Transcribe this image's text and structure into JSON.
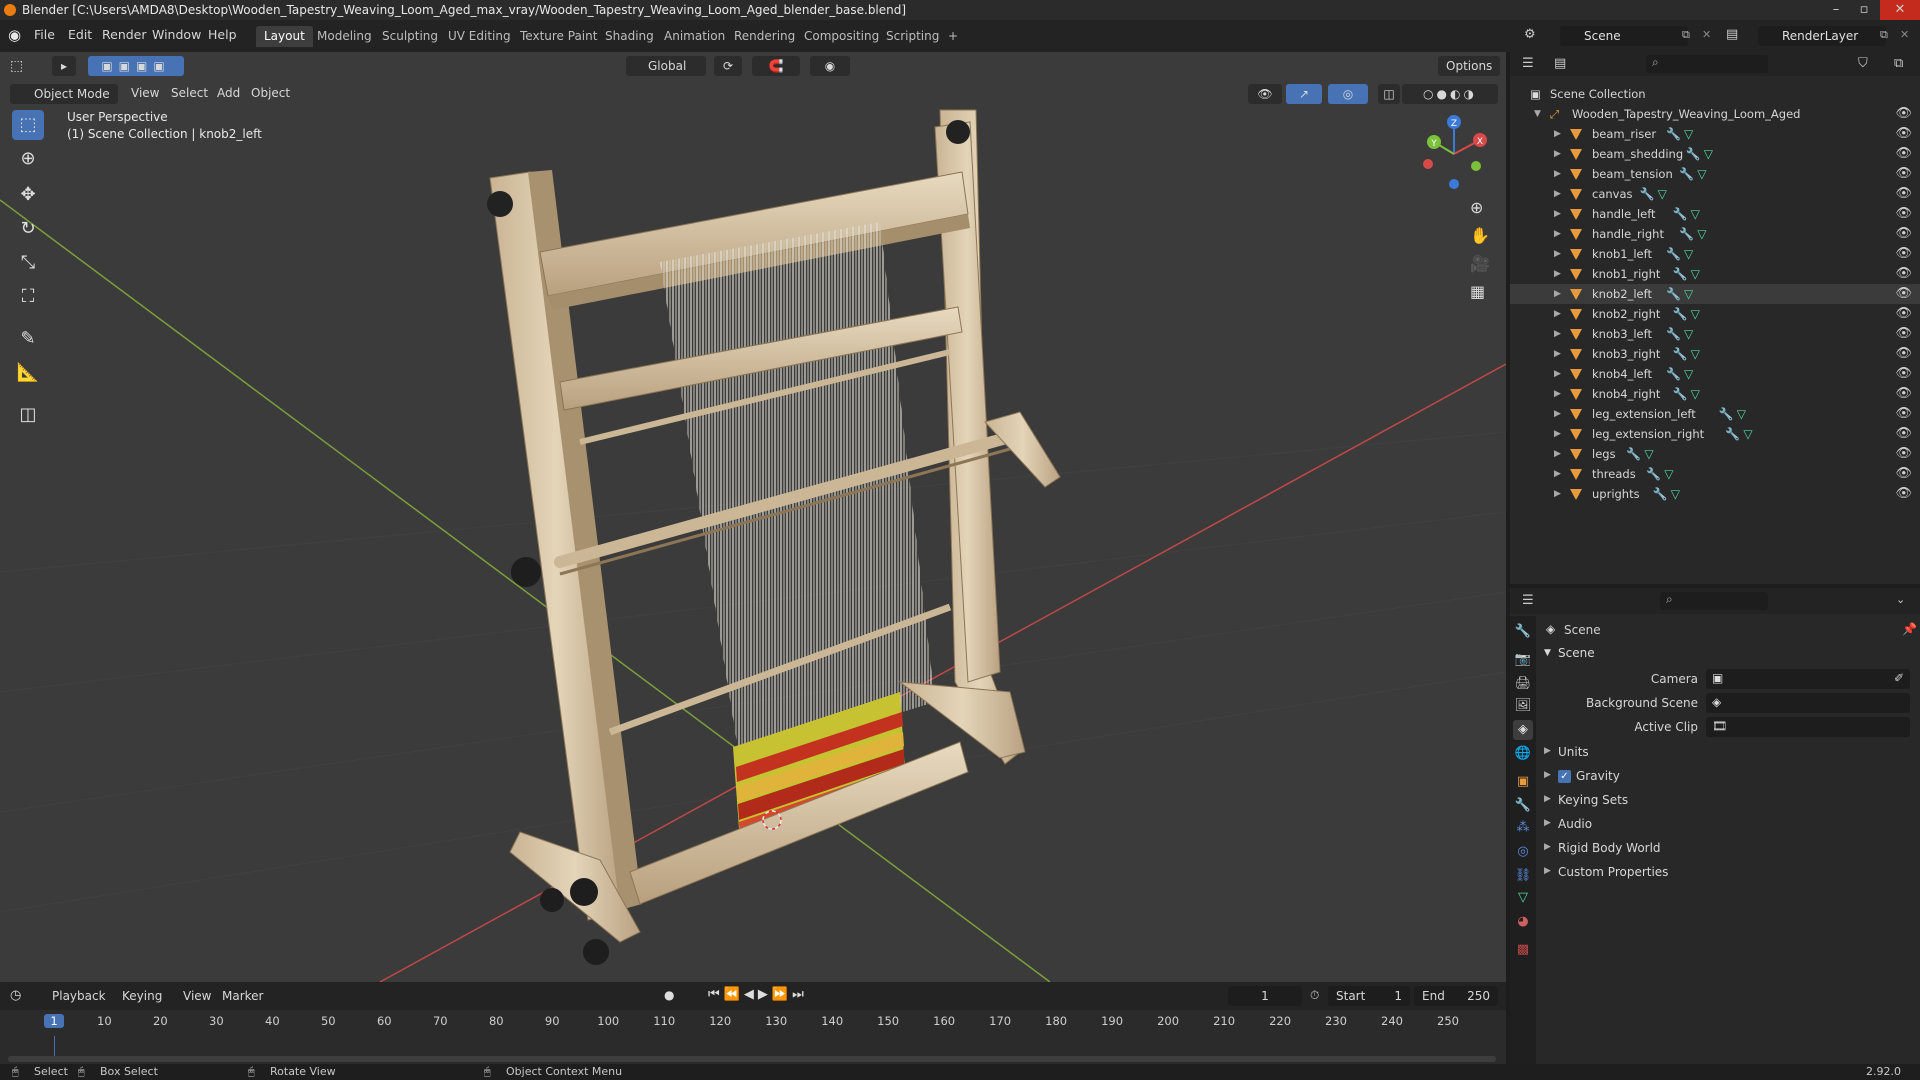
{
  "window": {
    "title": "Blender [C:\\Users\\AMDA8\\Desktop\\Wooden_Tapestry_Weaving_Loom_Aged_max_vray/Wooden_Tapestry_Weaving_Loom_Aged_blender_base.blend]"
  },
  "menu": [
    "File",
    "Edit",
    "Render",
    "Window",
    "Help"
  ],
  "workspaces": [
    {
      "label": "Layout",
      "active": true
    },
    {
      "label": "Modeling"
    },
    {
      "label": "Sculpting"
    },
    {
      "label": "UV Editing"
    },
    {
      "label": "Texture Paint"
    },
    {
      "label": "Shading"
    },
    {
      "label": "Animation"
    },
    {
      "label": "Rendering"
    },
    {
      "label": "Compositing"
    },
    {
      "label": "Scripting"
    }
  ],
  "add_workspace": "+",
  "scene_field": "Scene",
  "renderlayer_field": "RenderLayer",
  "viewport_header": {
    "transform_orientation": "Global",
    "options": "Options",
    "mode": "Object Mode",
    "menus": [
      "View",
      "Select",
      "Add",
      "Object"
    ]
  },
  "viewport": {
    "perspective": "User Perspective",
    "collection_info": "(1) Scene Collection | knob2_left",
    "gizmo_axes": {
      "x": "X",
      "y": "Y",
      "z": "Z"
    }
  },
  "outliner": {
    "root": "Scene Collection",
    "collection": "Wooden_Tapestry_Weaving_Loom_Aged",
    "objects": [
      "beam_riser",
      "beam_shedding",
      "beam_tension",
      "canvas",
      "handle_left",
      "handle_right",
      "knob1_left",
      "knob1_right",
      "knob2_left",
      "knob2_right",
      "knob3_left",
      "knob3_right",
      "knob4_left",
      "knob4_right",
      "leg_extension_left",
      "leg_extension_right",
      "legs",
      "threads",
      "uprights"
    ],
    "selected": "knob2_left"
  },
  "properties": {
    "context": "Scene",
    "panel": "Scene",
    "fields": [
      {
        "label": "Camera",
        "value": ""
      },
      {
        "label": "Background Scene",
        "value": ""
      },
      {
        "label": "Active Clip",
        "value": ""
      }
    ],
    "subpanels": [
      {
        "label": "Units"
      },
      {
        "label": "Gravity",
        "checked": true
      },
      {
        "label": "Keying Sets"
      },
      {
        "label": "Audio"
      },
      {
        "label": "Rigid Body World"
      },
      {
        "label": "Custom Properties"
      }
    ]
  },
  "timeline": {
    "menus": [
      "Playback",
      "Keying",
      "View",
      "Marker"
    ],
    "current_frame": "1",
    "start_label": "Start",
    "start": "1",
    "end_label": "End",
    "end": "250",
    "ticks": [
      "1",
      "10",
      "20",
      "30",
      "40",
      "50",
      "60",
      "70",
      "80",
      "90",
      "100",
      "110",
      "120",
      "130",
      "140",
      "150",
      "160",
      "170",
      "180",
      "190",
      "200",
      "210",
      "220",
      "230",
      "240",
      "250"
    ]
  },
  "statusbar": {
    "select": "Select",
    "box_select": "Box Select",
    "rotate": "Rotate View",
    "context_menu": "Object Context Menu",
    "version": "2.92.0"
  },
  "colors": {
    "accent": "#4772b3",
    "object_orange": "#e89a3c",
    "mesh_green": "#4fd8a0",
    "axis_red": "#c04848",
    "axis_green": "#7aa03a"
  }
}
